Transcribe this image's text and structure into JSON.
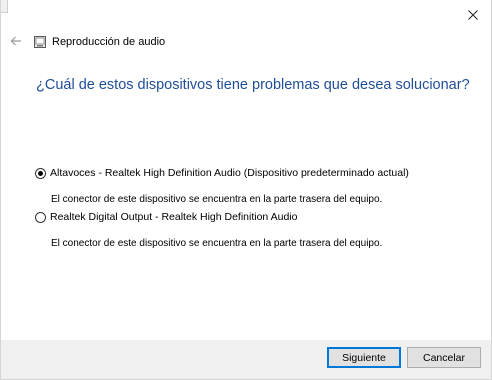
{
  "window": {
    "title": "Reproducción de audio",
    "close_icon": "close-icon",
    "back_icon": "back-arrow-icon",
    "app_icon": "audio-troubleshooter-icon"
  },
  "main": {
    "heading": "¿Cuál de estos dispositivos tiene problemas que desea solucionar?",
    "options": [
      {
        "label": "Altavoces - Realtek High Definition Audio (Dispositivo predeterminado actual)",
        "description": "El conector de este dispositivo se encuentra en la parte trasera del equipo.",
        "selected": true
      },
      {
        "label": "Realtek Digital Output - Realtek High Definition Audio",
        "description": "El conector de este dispositivo se encuentra en la parte trasera del equipo.",
        "selected": false
      }
    ]
  },
  "footer": {
    "next_label": "Siguiente",
    "cancel_label": "Cancelar"
  },
  "colors": {
    "heading": "#1f4e99",
    "footer_bg": "#f0f0f0",
    "primary_border": "#0078d7"
  }
}
